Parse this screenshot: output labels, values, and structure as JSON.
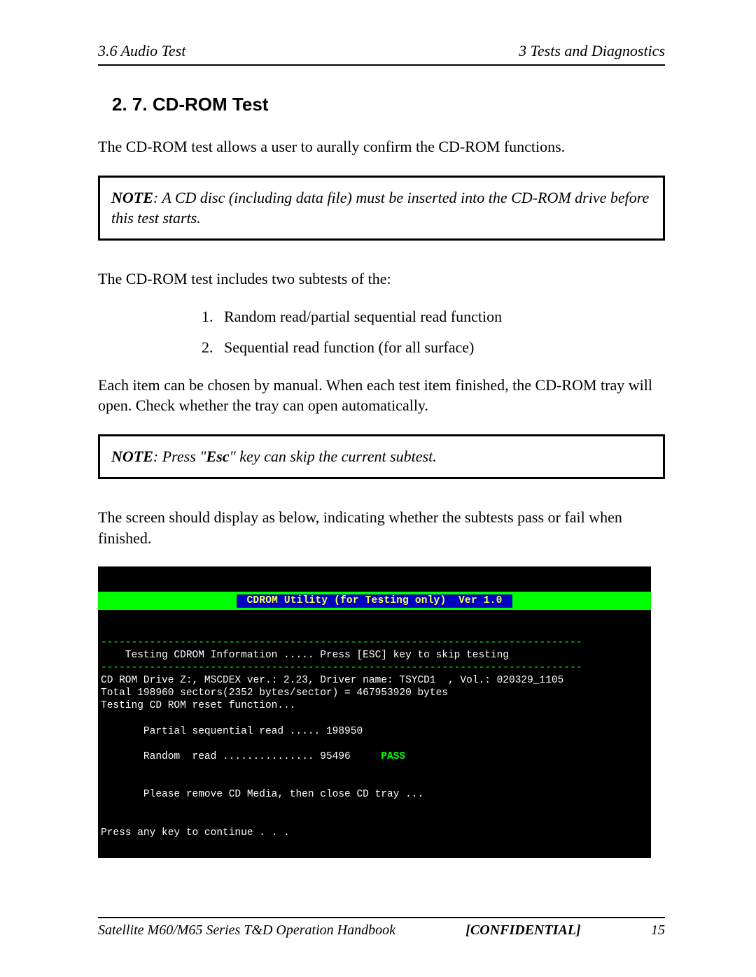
{
  "header": {
    "left": "3.6  Audio Test",
    "right": "3  Tests and Diagnostics"
  },
  "section": {
    "heading": "2. 7. CD-ROM Test"
  },
  "paragraphs": {
    "intro": "The CD-ROM test allows a user to aurally confirm the CD-ROM functions.",
    "subtests_intro": "The CD-ROM test includes two subtests of the:",
    "after_list": "Each item can be chosen by manual. When each test item finished, the CD-ROM tray will open. Check whether the tray can open automatically.",
    "screen_intro": "The screen should display as below, indicating whether the subtests pass or fail when finished."
  },
  "notes": {
    "note1_label": "NOTE",
    "note1_body": ":  A CD disc (including data file) must be inserted into the CD-ROM drive before this test starts.",
    "note2_label": "NOTE",
    "note2_body_pre": ":  Press \"",
    "note2_key": "Esc",
    "note2_body_post": "\" key can skip the current subtest."
  },
  "subtests": {
    "item1": "Random read/partial sequential read function",
    "item2": "Sequential read function (for all surface)"
  },
  "terminal": {
    "title": " CDROM Utility (for Testing only)  Ver 1.0 ",
    "dash": "-------------------------------------------------------------------------------",
    "info_line": "    Testing CDROM Information ..... Press [ESC] key to skip testing",
    "drive_line": "CD ROM Drive Z:, MSCDEX ver.: 2.23, Driver name: TSYCD1  , Vol.: 020329_1105",
    "total_line": "Total 198960 sectors(2352 bytes/sector) = 467953920 bytes",
    "reset_line": "Testing CD ROM reset function...",
    "partial_line": "       Partial sequential read ..... 198950",
    "random_line_pre": "       Random  read ............... 95496     ",
    "random_pass": "PASS",
    "remove_line": "       Please remove CD Media, then close CD tray ...",
    "continue_line": "Press any key to continue . . ."
  },
  "footer": {
    "left": "Satellite M60/M65 Series T&D Operation Handbook",
    "center": "[CONFIDENTIAL]",
    "right": "15"
  }
}
